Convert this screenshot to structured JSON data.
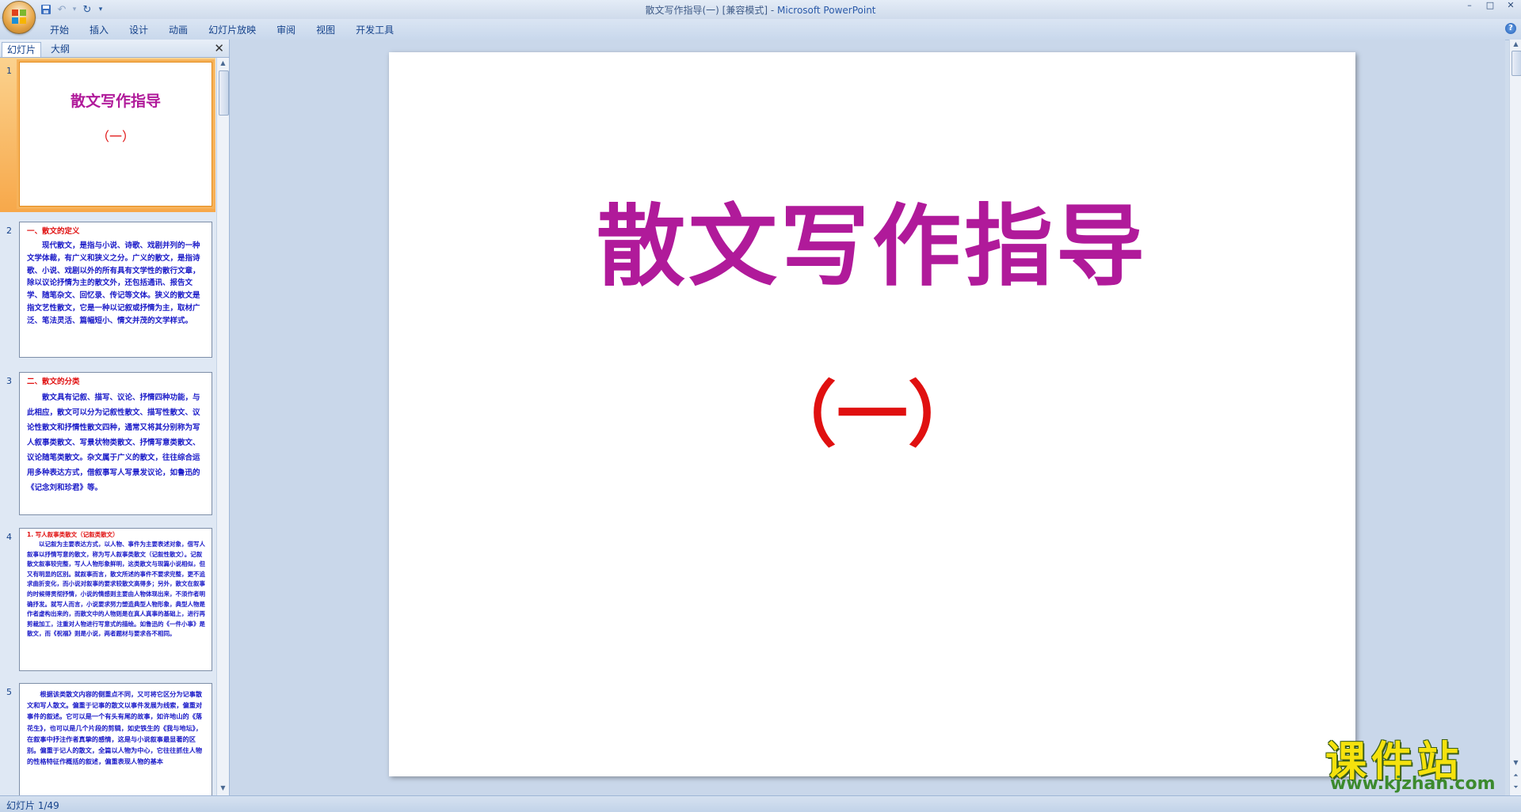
{
  "window": {
    "title_doc": "散文写作指导(一) [兼容模式] - ",
    "title_app": "Microsoft PowerPoint",
    "min": "–",
    "max": "□",
    "close": "✕"
  },
  "qat": {
    "save_icon": "save-icon",
    "undo_icon": "undo-icon",
    "redo_icon": "redo-icon",
    "customize_icon": "customize-icon"
  },
  "ribbon": {
    "tabs": [
      "开始",
      "插入",
      "设计",
      "动画",
      "幻灯片放映",
      "审阅",
      "视图",
      "开发工具"
    ],
    "help": "?"
  },
  "left_pane": {
    "tab_slides": "幻灯片",
    "tab_outline": "大纲",
    "close": "✕"
  },
  "thumbnails": [
    {
      "num": "1",
      "title": "散文写作指导",
      "sub": "（一）"
    },
    {
      "num": "2",
      "heading": "一、散文的定义",
      "body_html": "现代散文，是指与小说、诗歌、戏剧并列的一种文学体裁，有广义和狭义之分。广义的散文，是指诗歌、小说、戏剧以外的所有具有文学性的散行文章，除以议论抒情为主的散文外，还包括通讯、报告文学、随笔杂文、回忆录、传记等文体。狭义的散文是指文艺性散文，它是一种以记叙或抒情为主，取材广泛、笔法灵活、篇幅短小、情文并茂的文学样式。"
    },
    {
      "num": "3",
      "heading": "二、散文的分类",
      "body_html": "散文具有记叙、描写、议论、抒情四种功能，与此相应，散文可以分为记叙性散文、描写性散文、议论性散文和抒情性散文四种，通常又将其分别称为写人叙事类散文、写景状物类散文、抒情写意类散文、议论随笔类散文。杂文属于广义的散文，往往综合运用多种表达方式，借叙事写人写景发议论，如鲁迅的《记念刘和珍君》等。"
    },
    {
      "num": "4",
      "heading": "1. 写人叙事类散文（记叙类散文）",
      "body_html": "以记叙为主要表达方式，以人物、事件为主要表述对象，借写人叙事以抒情写意的散文，称为写人叙事类散文（记叙性散文）。记叙散文叙事较完整，写人人物形象鲜明，这类散文与现篇小说相似，但又有明显的区别。就叙事而言，散文所述的事件不要求完整，更不追求曲折变化，而小说对叙事的要求较散文高得多；另外，散文在叙事的时候得贯彻抒情，小说的情感则主要由人物体现出来，不须作者明确抒发。就写人而言，小说要求努力塑造典型人物形象，典型人物是作者虚构出来的，而散文中的人物则是在真人真事的基础上，进行再剪裁加工，注重对人物进行写意式的描绘。如鲁迅的《一件小事》是散文，而《祝福》则是小说，两者题材与要求各不相同。"
    },
    {
      "num": "5",
      "body_html": "根据该类散文内容的侧重点不同，又可将它区分为记事散文和写人散文。偏重于记事的散文以事件发展为线索，偏重对事件的叙述。它可以是一个有头有尾的故事，如许地山的《落花生》，也可以是几个片段的剪辑，如史铁生的《我与地坛》，在叙事中抒注作者真挚的感情，这是与小说叙事最显著的区别。偏重于记人的散文，全篇以人物为中心，它往往抓住人物的性格特征作概括的叙述，偏重表现人物的基本"
    }
  ],
  "slide": {
    "title": "散文写作指导",
    "subtitle": "（一）"
  },
  "status": {
    "text": "幻灯片 1/49"
  },
  "watermark": {
    "cn": "课件站",
    "url": "www.kjzhan.com"
  }
}
